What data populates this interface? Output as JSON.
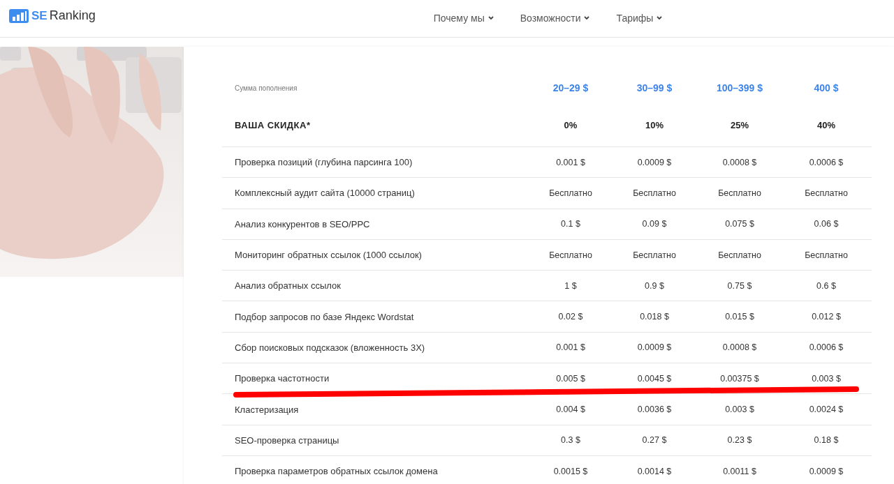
{
  "header": {
    "logo": {
      "mark": "SE",
      "name": "Ranking"
    },
    "nav": [
      {
        "label": "Почему мы"
      },
      {
        "label": "Возможности"
      },
      {
        "label": "Тарифы"
      }
    ]
  },
  "table": {
    "caption": "Сумма пополнения",
    "amounts": [
      "20–29 $",
      "30–99 $",
      "100–399 $",
      "400 $"
    ],
    "discount_label": "ВАША СКИДКА*",
    "discounts": [
      "0%",
      "10%",
      "25%",
      "40%"
    ],
    "rows": [
      {
        "name": "Проверка позиций (глубина парсинга 100)",
        "values": [
          "0.001 $",
          "0.0009 $",
          "0.0008 $",
          "0.0006 $"
        ],
        "underlined": false
      },
      {
        "name": "Комплексный аудит сайта (10000 страниц)",
        "values": [
          "Бесплатно",
          "Бесплатно",
          "Бесплатно",
          "Бесплатно"
        ],
        "underlined": false
      },
      {
        "name": "Анализ конкурентов в SEO/PPC",
        "values": [
          "0.1 $",
          "0.09 $",
          "0.075 $",
          "0.06 $"
        ],
        "underlined": false
      },
      {
        "name": "Мониторинг обратных ссылок (1000 ссылок)",
        "values": [
          "Бесплатно",
          "Бесплатно",
          "Бесплатно",
          "Бесплатно"
        ],
        "underlined": false
      },
      {
        "name": "Анализ обратных ссылок",
        "values": [
          "1 $",
          "0.9 $",
          "0.75 $",
          "0.6 $"
        ],
        "underlined": false
      },
      {
        "name": "Подбор запросов по базе Яндекс Wordstat",
        "values": [
          "0.02 $",
          "0.018 $",
          "0.015 $",
          "0.012 $"
        ],
        "underlined": false
      },
      {
        "name": "Сбор поисковых подсказок (вложенность 3Х)",
        "values": [
          "0.001 $",
          "0.0009 $",
          "0.0008 $",
          "0.0006 $"
        ],
        "underlined": false
      },
      {
        "name": "Проверка частотности",
        "values": [
          "0.005 $",
          "0.0045 $",
          "0.00375 $",
          "0.003 $"
        ],
        "underlined": true
      },
      {
        "name": "Кластеризация",
        "values": [
          "0.004 $",
          "0.0036 $",
          "0.003 $",
          "0.0024 $"
        ],
        "underlined": false
      },
      {
        "name": "SEO-проверка страницы",
        "values": [
          "0.3 $",
          "0.27 $",
          "0.23 $",
          "0.18 $"
        ],
        "underlined": false
      },
      {
        "name": "Проверка параметров обратных ссылок домена",
        "values": [
          "0.0015 $",
          "0.0014 $",
          "0.0011 $",
          "0.0009 $"
        ],
        "underlined": false
      }
    ]
  }
}
